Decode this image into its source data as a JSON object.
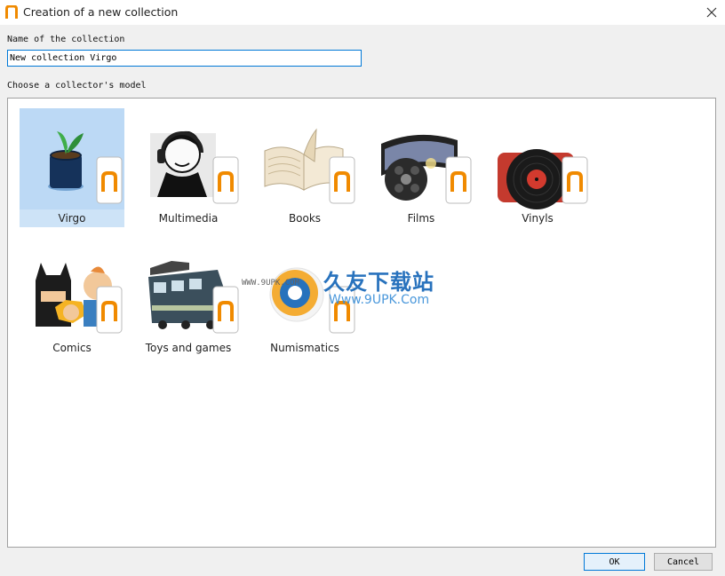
{
  "window": {
    "title": "Creation of a new collection",
    "close_glyph": "✕"
  },
  "form": {
    "name_label": "Name of the collection",
    "name_value": "New collection Virgo",
    "model_label": "Choose a collector's model"
  },
  "models": [
    {
      "label": "Virgo",
      "icon": "plant-pot-icon",
      "selected": true
    },
    {
      "label": "Multimedia",
      "icon": "headphones-man-icon",
      "selected": false
    },
    {
      "label": "Books",
      "icon": "open-book-icon",
      "selected": false
    },
    {
      "label": "Films",
      "icon": "film-reel-icon",
      "selected": false
    },
    {
      "label": "Vinyls",
      "icon": "vinyl-record-icon",
      "selected": false
    },
    {
      "label": "Comics",
      "icon": "comic-heroes-icon",
      "selected": false
    },
    {
      "label": "Toys and games",
      "icon": "toy-train-icon",
      "selected": false
    },
    {
      "label": "Numismatics",
      "icon": "coin-icon",
      "selected": false
    }
  ],
  "watermark": {
    "cn_text": "久友下载站",
    "url_text": "Www.9UPK.Com",
    "small_text": "WWW.9UPK.COM"
  },
  "buttons": {
    "ok": "OK",
    "cancel": "Cancel"
  },
  "colors": {
    "accent": "#0078d7",
    "brand_orange": "#f08a00",
    "selection": "#bcd9f5"
  }
}
